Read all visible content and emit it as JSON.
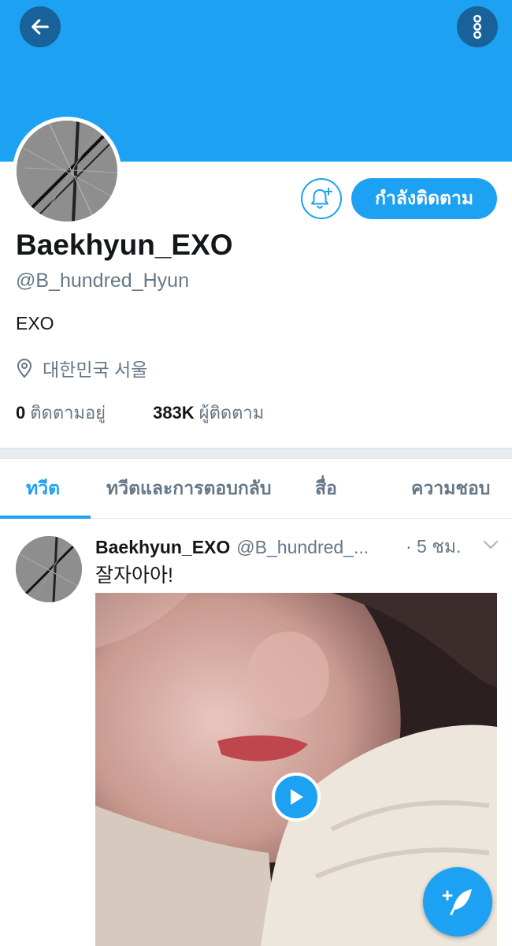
{
  "header": {
    "back_icon": "arrow-left-icon",
    "more_icon": "more-vertical-icon",
    "banner_color": "#1da1f2"
  },
  "profile": {
    "display_name": "Baekhyun_EXO",
    "handle": "@B_hundred_Hyun",
    "bio": "EXO",
    "location": "대한민국 서울",
    "following_count": "0",
    "following_label": "ติดตามอยู่",
    "followers_count": "383K",
    "followers_label": "ผู้ติดตาม",
    "follow_button_label": "กำลังติดตาม",
    "notify_icon": "bell-plus-icon"
  },
  "tabs": [
    {
      "label": "ทวีต",
      "active": true
    },
    {
      "label": "ทวีตและการตอบกลับ",
      "active": false
    },
    {
      "label": "สื่อ",
      "active": false
    },
    {
      "label": "ความชอบ",
      "active": false
    }
  ],
  "tweet": {
    "name": "Baekhyun_EXO",
    "handle": "@B_hundred_...",
    "time": "· 5 ชม.",
    "text": "잘자아아!",
    "media_type": "video",
    "play_icon": "play-icon",
    "caret_icon": "chevron-down-icon"
  },
  "fab": {
    "icon": "compose-tweet-icon"
  },
  "colors": {
    "accent": "#1da1f2",
    "secondary_text": "#657786",
    "primary_text": "#14171a"
  }
}
